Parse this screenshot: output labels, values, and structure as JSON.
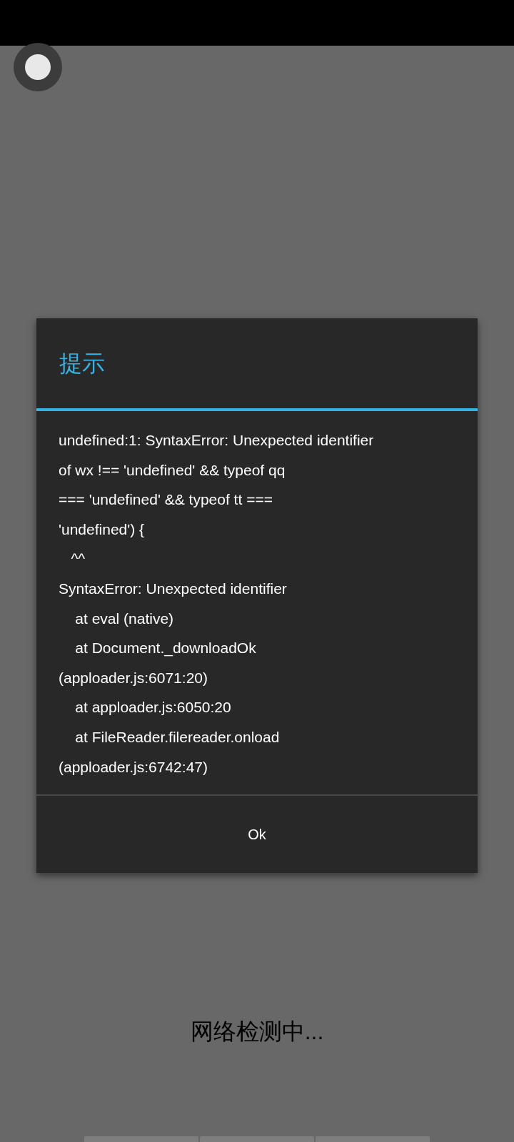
{
  "dialog": {
    "title": "提示",
    "message_lines": [
      "undefined:1: SyntaxError: Unexpected identifier",
      "of wx !== 'undefined' && typeof qq",
      "=== 'undefined' && typeof tt ===",
      "'undefined') {",
      "   ^^",
      "SyntaxError: Unexpected identifier",
      "    at eval (native)",
      "    at Document._downloadOk",
      "(apploader.js:6071:20)",
      "    at apploader.js:6050:20",
      "    at FileReader.filereader.onload",
      "(apploader.js:6742:47)"
    ],
    "button": "Ok"
  },
  "status_text": "网络检测中..."
}
